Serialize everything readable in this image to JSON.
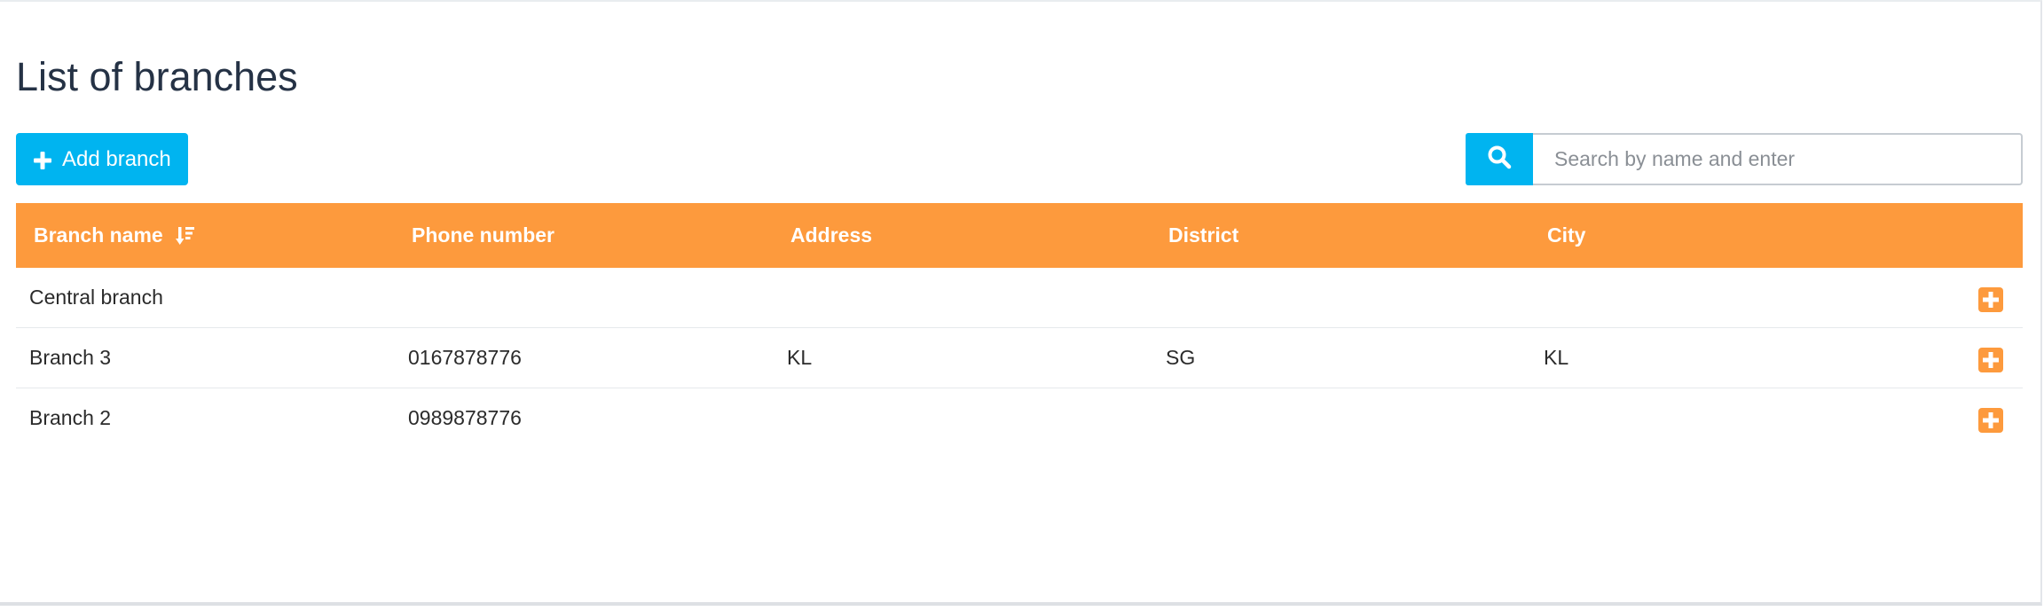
{
  "page": {
    "title": "List of branches"
  },
  "toolbar": {
    "add_label": "Add branch",
    "search_placeholder": "Search by name and enter",
    "search_value": ""
  },
  "table": {
    "columns": [
      "Branch name",
      "Phone number",
      "Address",
      "District",
      "City"
    ],
    "sort_column": "Branch name",
    "rows": [
      {
        "name": "Central branch",
        "phone": "",
        "address": "",
        "district": "",
        "city": ""
      },
      {
        "name": "Branch 3",
        "phone": "0167878776",
        "address": "KL",
        "district": "SG",
        "city": "KL"
      },
      {
        "name": "Branch 2",
        "phone": "0989878776",
        "address": "",
        "district": "",
        "city": ""
      }
    ]
  },
  "icons": {
    "add": "plus-icon",
    "search": "search-icon",
    "sort": "sort-desc-icon",
    "row_action": "plus-square-icon"
  },
  "colors": {
    "accent": "#00b4f0",
    "header": "#fd9a3d",
    "title": "#253245"
  }
}
